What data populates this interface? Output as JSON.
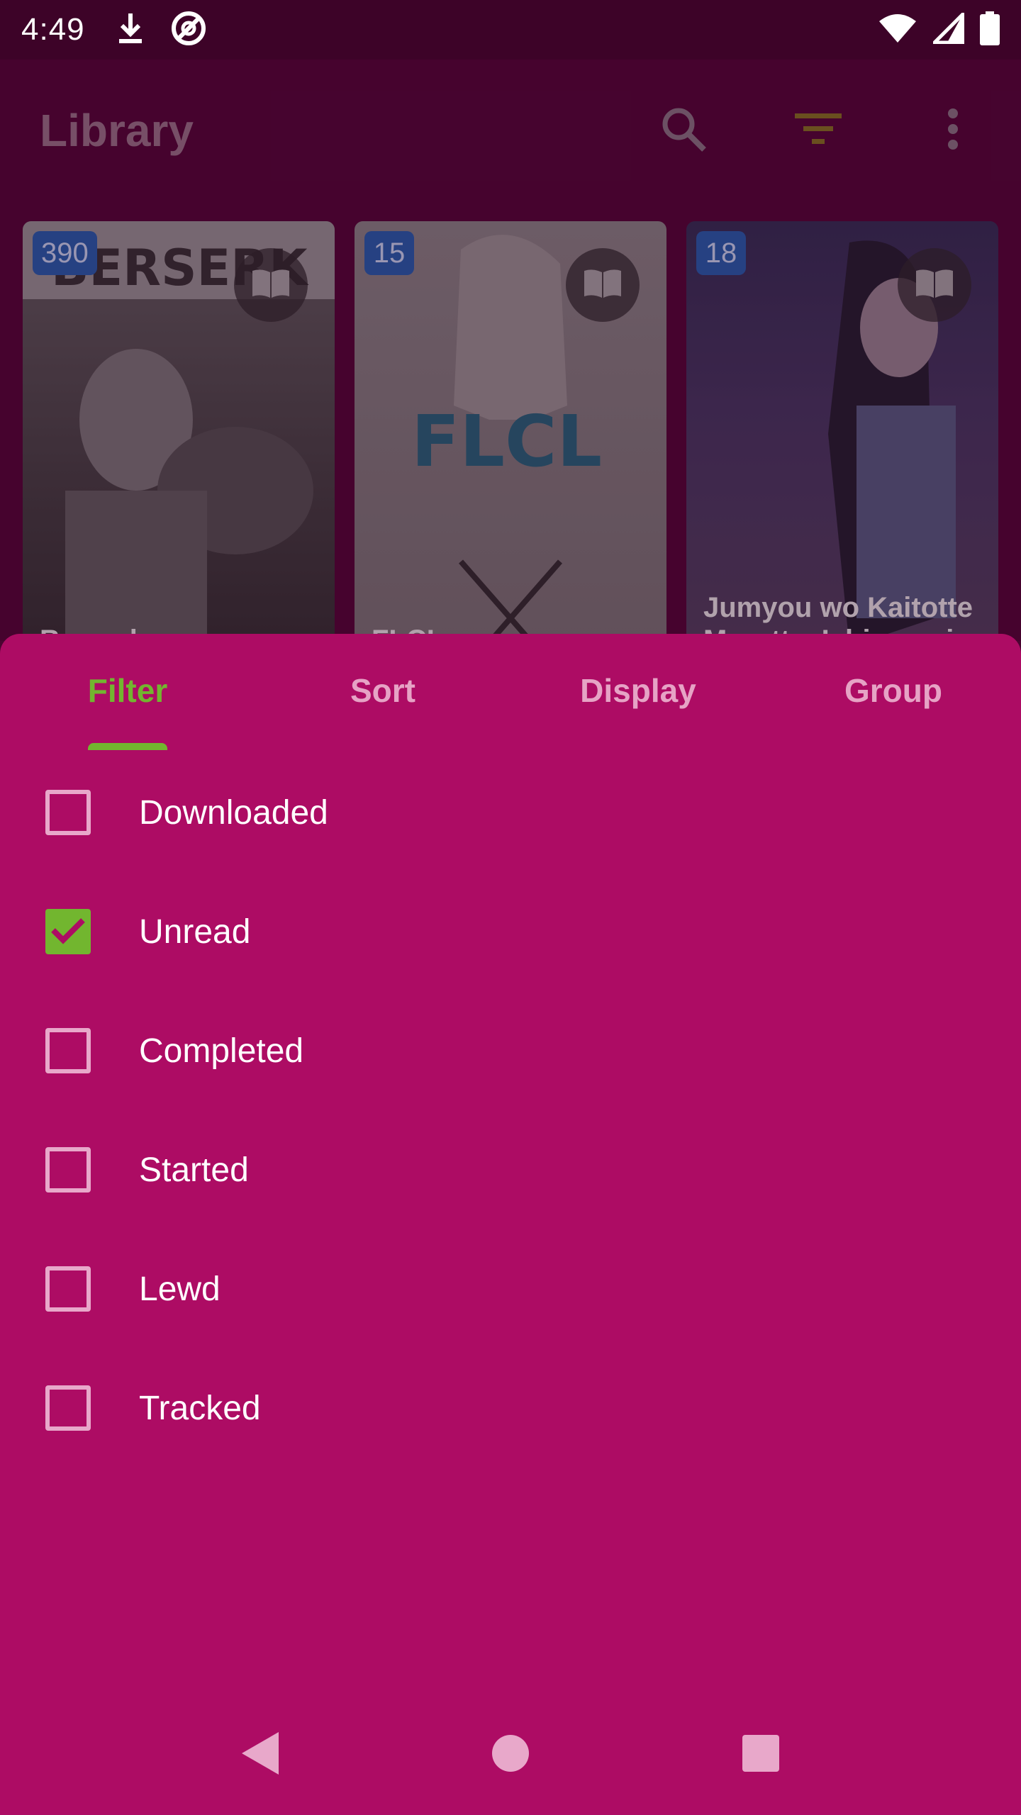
{
  "status_bar": {
    "time": "4:49",
    "icons": [
      "download-icon",
      "sync-icon",
      "wifi-icon",
      "signal-icon",
      "battery-icon"
    ]
  },
  "app_bar": {
    "title": "Library",
    "actions": [
      "search-icon",
      "filter-icon",
      "more-vert-icon"
    ],
    "accent_color": "#7a6a1c"
  },
  "library": {
    "items": [
      {
        "title": "Berserk",
        "unread_count": "390"
      },
      {
        "title": "FLCL",
        "unread_count": "15"
      },
      {
        "title": "Jumyou wo Kaitotte Moratta. Ichinen ni",
        "unread_count": "18"
      }
    ]
  },
  "sheet": {
    "background": "#ad0c64",
    "accent": "#72b62f",
    "tabs": [
      {
        "label": "Filter",
        "active": true
      },
      {
        "label": "Sort",
        "active": false
      },
      {
        "label": "Display",
        "active": false
      },
      {
        "label": "Group",
        "active": false
      }
    ],
    "filters": [
      {
        "label": "Downloaded",
        "checked": false
      },
      {
        "label": "Unread",
        "checked": true
      },
      {
        "label": "Completed",
        "checked": false
      },
      {
        "label": "Started",
        "checked": false
      },
      {
        "label": "Lewd",
        "checked": false
      },
      {
        "label": "Tracked",
        "checked": false
      }
    ]
  },
  "nav_bar": {
    "buttons": [
      "back-icon",
      "home-icon",
      "recents-icon"
    ]
  }
}
